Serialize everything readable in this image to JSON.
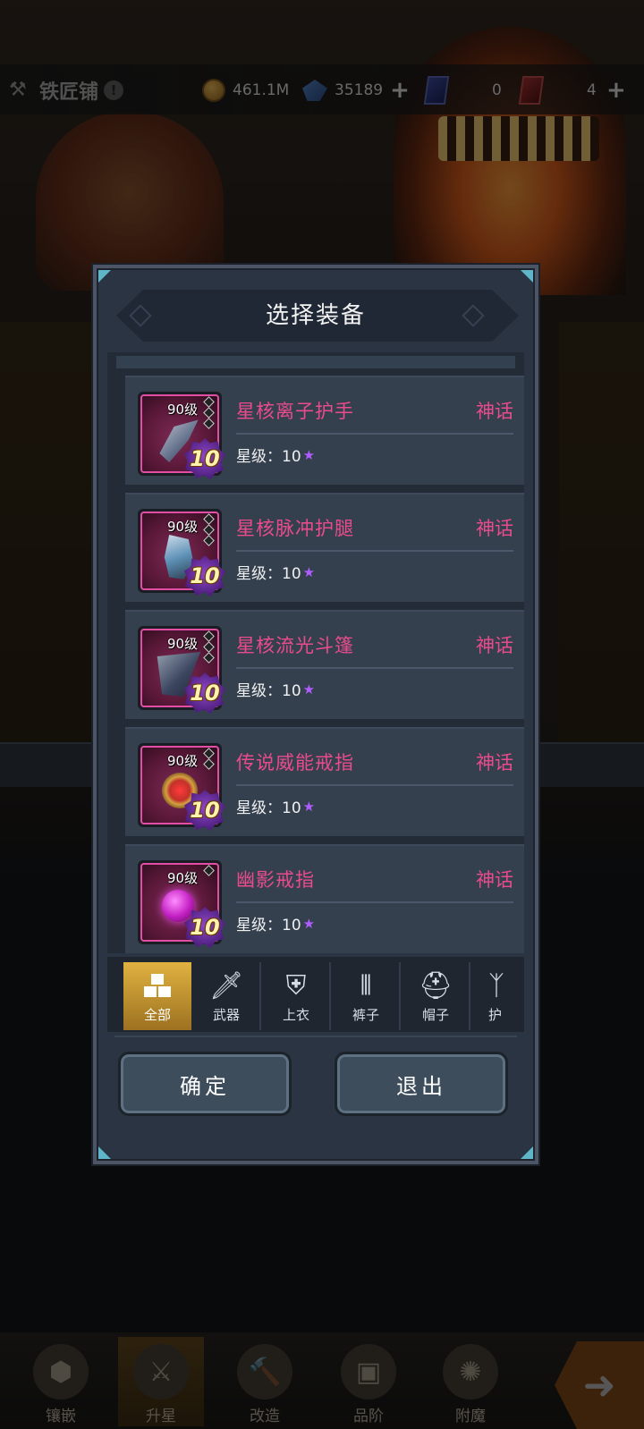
{
  "topbar": {
    "title": "铁匠铺",
    "gold": "461.1M",
    "gems": "35189",
    "blue_cards": "0",
    "red_cards": "4"
  },
  "dialog": {
    "title": "选择装备",
    "items": [
      {
        "level": "90级",
        "stars": "10",
        "name": "星核离子护手",
        "rarity": "神话",
        "star_label": "星级：10",
        "gem_slots": 3,
        "art": "gauntlet"
      },
      {
        "level": "90级",
        "stars": "10",
        "name": "星核脉冲护腿",
        "rarity": "神话",
        "star_label": "星级：10",
        "gem_slots": 3,
        "art": "legs"
      },
      {
        "level": "90级",
        "stars": "10",
        "name": "星核流光斗篷",
        "rarity": "神话",
        "star_label": "星级：10",
        "gem_slots": 3,
        "art": "cloak"
      },
      {
        "level": "90级",
        "stars": "10",
        "name": "传说威能戒指",
        "rarity": "神话",
        "star_label": "星级：10",
        "gem_slots": 2,
        "art": "ring"
      },
      {
        "level": "90级",
        "stars": "10",
        "name": "幽影戒指",
        "rarity": "神话",
        "star_label": "星级：10",
        "gem_slots": 1,
        "art": "orb"
      }
    ],
    "tabs": [
      "全部",
      "武器",
      "上衣",
      "裤子",
      "帽子",
      "护"
    ],
    "confirm": "确定",
    "exit": "退出"
  },
  "bottomnav": [
    "镶嵌",
    "升星",
    "改造",
    "品阶",
    "附魔"
  ],
  "colors": {
    "rarity_mythic": "#e94b8c",
    "tab_active": "#e0b241",
    "dialog_bg": "#2b3443"
  }
}
